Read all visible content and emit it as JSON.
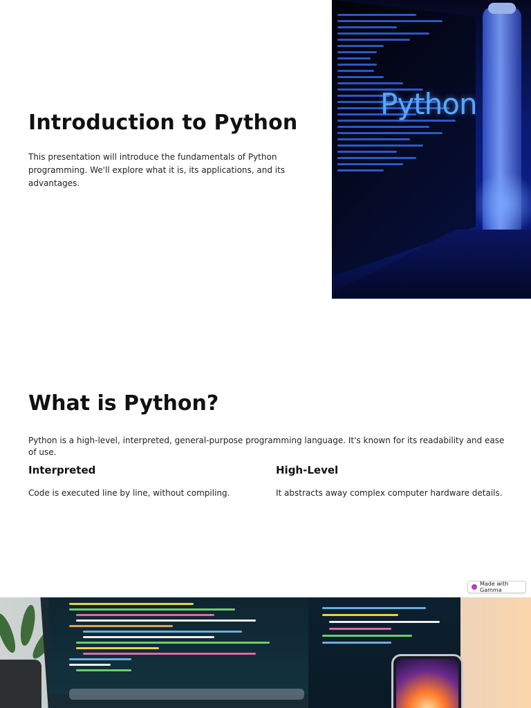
{
  "slides": [
    {
      "title": "Introduction to Python",
      "body": "This presentation will introduce the fundamentals of Python programming. We'll explore what it is, its applications, and its advantages.",
      "image_icon": "python-code-monitor-image",
      "image_text": "Python"
    },
    {
      "title": "What is Python?",
      "body": "Python is a high-level, interpreted, general-purpose programming language. It's known for its readability and ease of use.",
      "columns": [
        {
          "title": "Interpreted",
          "text": "Code is executed line by line, without compiling."
        },
        {
          "title": "High-Level",
          "text": "It abstracts away complex computer hardware details."
        }
      ]
    },
    {
      "image_icon": "laptop-code-workspace-image"
    }
  ],
  "badge": {
    "label": "Made with Gamma",
    "icon": "gamma-logo-icon"
  },
  "colors": {
    "accent_blue": "#3a74ff",
    "python_text": "#5aa6ff"
  }
}
